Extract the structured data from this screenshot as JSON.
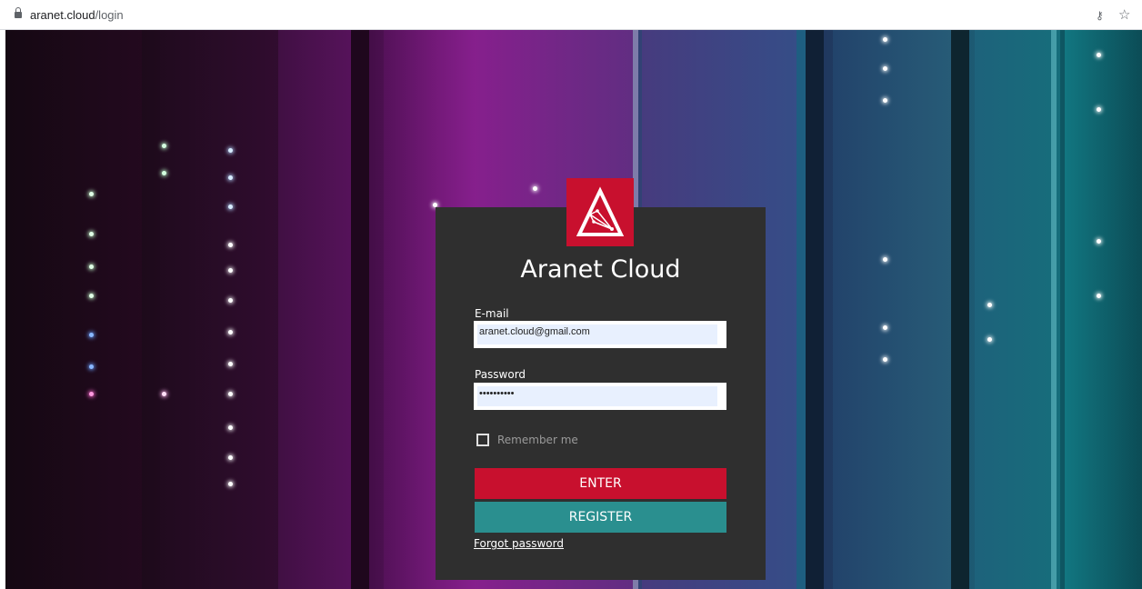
{
  "browser": {
    "url_host": "aranet.cloud",
    "url_path": "/login",
    "lock_icon": "lock-icon",
    "key_icon": "key-icon",
    "star_icon": "star-icon"
  },
  "login": {
    "logo_icon": "aranet-logo-icon",
    "title": "Aranet Cloud",
    "email_label": "E-mail",
    "email_value": "aranet.cloud@gmail.com",
    "password_label": "Password",
    "password_value": "••••••••••",
    "remember_label": "Remember me",
    "remember_checked": false,
    "enter_label": "ENTER",
    "register_label": "REGISTER",
    "forgot_label": "Forgot password"
  },
  "colors": {
    "brand_red": "#c8102e",
    "register_teal": "#2a8f8f",
    "panel_bg": "#2f2f2f",
    "input_bg": "#e8f0fe"
  }
}
